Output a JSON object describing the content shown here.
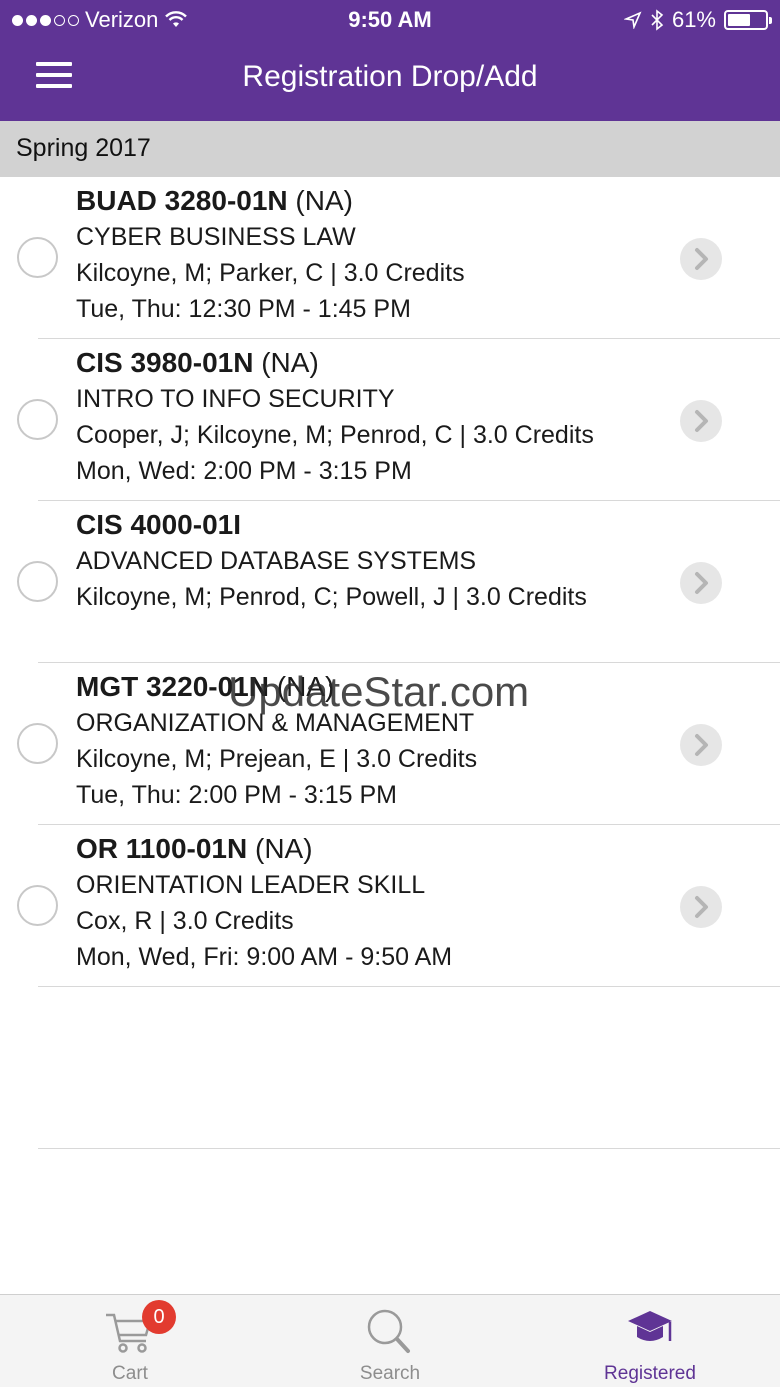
{
  "status_bar": {
    "carrier": "Verizon",
    "time": "9:50 AM",
    "battery": "61%",
    "battery_level": 0.61
  },
  "nav": {
    "title": "Registration  Drop/Add",
    "menu_icon": "hamburger-icon"
  },
  "term": "Spring 2017",
  "courses": [
    {
      "code": "BUAD 3280-01N",
      "status": "(NA)",
      "title": "CYBER BUSINESS LAW",
      "instructors": "Kilcoyne, M; Parker, C | 3.0 Credits",
      "schedule": "Tue, Thu: 12:30 PM - 1:45 PM"
    },
    {
      "code": "CIS 3980-01N",
      "status": "(NA)",
      "title": "INTRO TO INFO SECURITY",
      "instructors": "Cooper, J; Kilcoyne, M; Penrod, C | 3.0 Credits",
      "schedule": "Mon, Wed: 2:00 PM - 3:15 PM"
    },
    {
      "code": "CIS 4000-01I",
      "status": "",
      "title": "ADVANCED DATABASE SYSTEMS",
      "instructors": "Kilcoyne, M; Penrod, C; Powell, J | 3.0 Credits",
      "schedule": ""
    },
    {
      "code": "MGT 3220-01N",
      "status": "(NA)",
      "title": "ORGANIZATION & MANAGEMENT",
      "instructors": "Kilcoyne, M; Prejean, E | 3.0 Credits",
      "schedule": "Tue, Thu: 2:00 PM - 3:15 PM"
    },
    {
      "code": "OR 1100-01N",
      "status": "(NA)",
      "title": "ORIENTATION LEADER SKILL",
      "instructors": "Cox, R | 3.0 Credits",
      "schedule": "Mon, Wed, Fri: 9:00 AM - 9:50 AM"
    }
  ],
  "watermark": "UpdateStar.com",
  "tabs": [
    {
      "label": "Cart",
      "icon": "cart-icon",
      "badge": "0"
    },
    {
      "label": "Search",
      "icon": "search-icon"
    },
    {
      "label": "Registered",
      "icon": "graduation-cap-icon"
    }
  ],
  "colors": {
    "brand": "#5f3495",
    "badge": "#e23b2f",
    "term_bar": "#d2d2d2"
  }
}
